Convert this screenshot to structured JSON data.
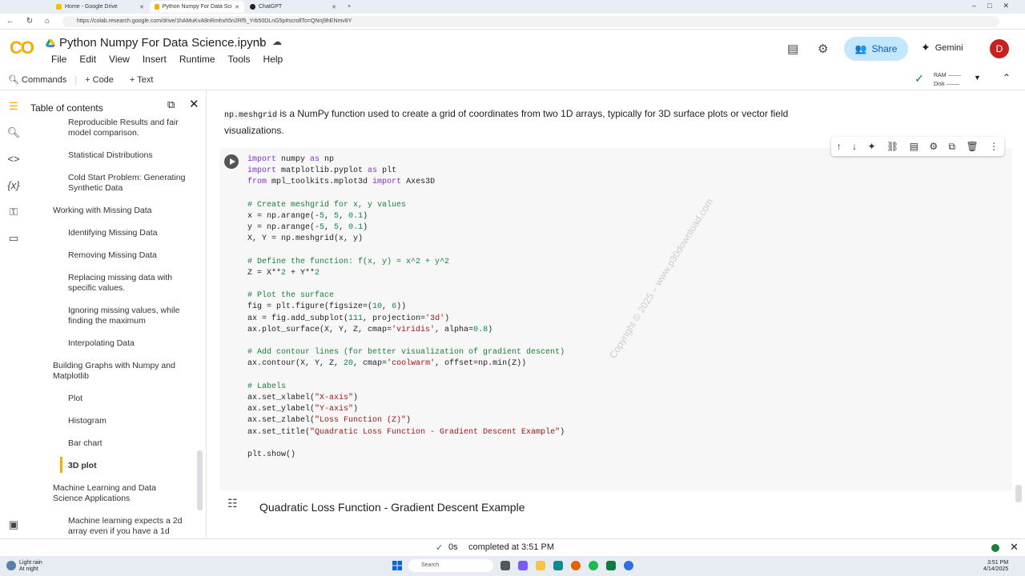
{
  "browser": {
    "tabs": [
      {
        "label": "Home - Google Drive",
        "color": "#fbbc04"
      },
      {
        "label": "Python Numpy For Data Science.i",
        "color": "#f9ab00"
      },
      {
        "label": "ChatGPT",
        "color": "#222222"
      }
    ],
    "url": "https://colab.research.google.com/drive/1hAMuKvA8nRmhxh5n2Rf5_Yrb50DLnG5p#scrollTo=QNnj9hENmv8Y"
  },
  "header": {
    "logo": "CO",
    "title": "Python Numpy For Data Science.ipynb",
    "menu": [
      "File",
      "Edit",
      "View",
      "Insert",
      "Runtime",
      "Tools",
      "Help"
    ],
    "share_label": "Share",
    "gemini_label": "Gemini",
    "avatar_letter": "D"
  },
  "toolbar": {
    "commands": "Commands",
    "add_code": "+ Code",
    "add_text": "+ Text",
    "ram": "RAM",
    "disk": "Disk"
  },
  "toc": {
    "title": "Table of contents",
    "items": [
      {
        "label": "Reproducible Results and fair model comparison.",
        "level": 2
      },
      {
        "label": "Statistical Distributions",
        "level": 2
      },
      {
        "label": "Cold Start Problem: Generating Synthetic Data",
        "level": 2
      },
      {
        "label": "Working with Missing Data",
        "level": 1
      },
      {
        "label": "Identifying Missing Data",
        "level": 2
      },
      {
        "label": "Removing Missing Data",
        "level": 2
      },
      {
        "label": "Replacing missing data with specific values.",
        "level": 2
      },
      {
        "label": "Ignoring missing values, while finding the maximum",
        "level": 2
      },
      {
        "label": "Interpolating Data",
        "level": 2
      },
      {
        "label": "Building Graphs with Numpy and Matplotlib",
        "level": 1
      },
      {
        "label": "Plot",
        "level": 2
      },
      {
        "label": "Histogram",
        "level": 2
      },
      {
        "label": "Bar chart",
        "level": 2
      },
      {
        "label": "3D plot",
        "level": 2,
        "active": true
      },
      {
        "label": "Machine Learning and Data Science Applications",
        "level": 1
      },
      {
        "label": "Machine learning expects a 2d array even if you have a 1d",
        "level": 2
      }
    ]
  },
  "main": {
    "desc_code": "np.meshgrid",
    "desc_text": " is a NumPy function used to create a grid of coordinates from two 1D arrays, typically for 3D surface plots or vector field visualizations.",
    "code_lines": [
      "import numpy as np",
      "import matplotlib.pyplot as plt",
      "from mpl_toolkits.mplot3d import Axes3D",
      "",
      "# Create meshgrid for x, y values",
      "x = np.arange(-5, 5, 0.1)",
      "y = np.arange(-5, 5, 0.1)",
      "X, Y = np.meshgrid(x, y)",
      "",
      "# Define the function: f(x, y) = x^2 + y^2",
      "Z = X**2 + Y**2",
      "",
      "# Plot the surface",
      "fig = plt.figure(figsize=(10, 6))",
      "ax = fig.add_subplot(111, projection='3d')",
      "ax.plot_surface(X, Y, Z, cmap='viridis', alpha=0.8)",
      "",
      "# Add contour lines (for better visualization of gradient descent)",
      "ax.contour(X, Y, Z, 20, cmap='coolwarm', offset=np.min(Z))",
      "",
      "# Labels",
      "ax.set_xlabel(\"X-axis\")",
      "ax.set_ylabel(\"Y-axis\")",
      "ax.set_zlabel(\"Loss Function (Z)\")",
      "ax.set_title(\"Quadratic Loss Function - Gradient Descent Example\")",
      "",
      "plt.show()"
    ],
    "output_title": "Quadratic Loss Function - Gradient Descent Example",
    "watermark": "Copyright © 2025 – www.p30download.com"
  },
  "status": {
    "elapsed": "0s",
    "completed": "completed at 3:51 PM"
  },
  "taskbar": {
    "weather_line1": "Light rain",
    "weather_line2": "At night",
    "search_placeholder": "Search",
    "clock_time": "3:51 PM",
    "clock_date": "4/14/2025"
  }
}
